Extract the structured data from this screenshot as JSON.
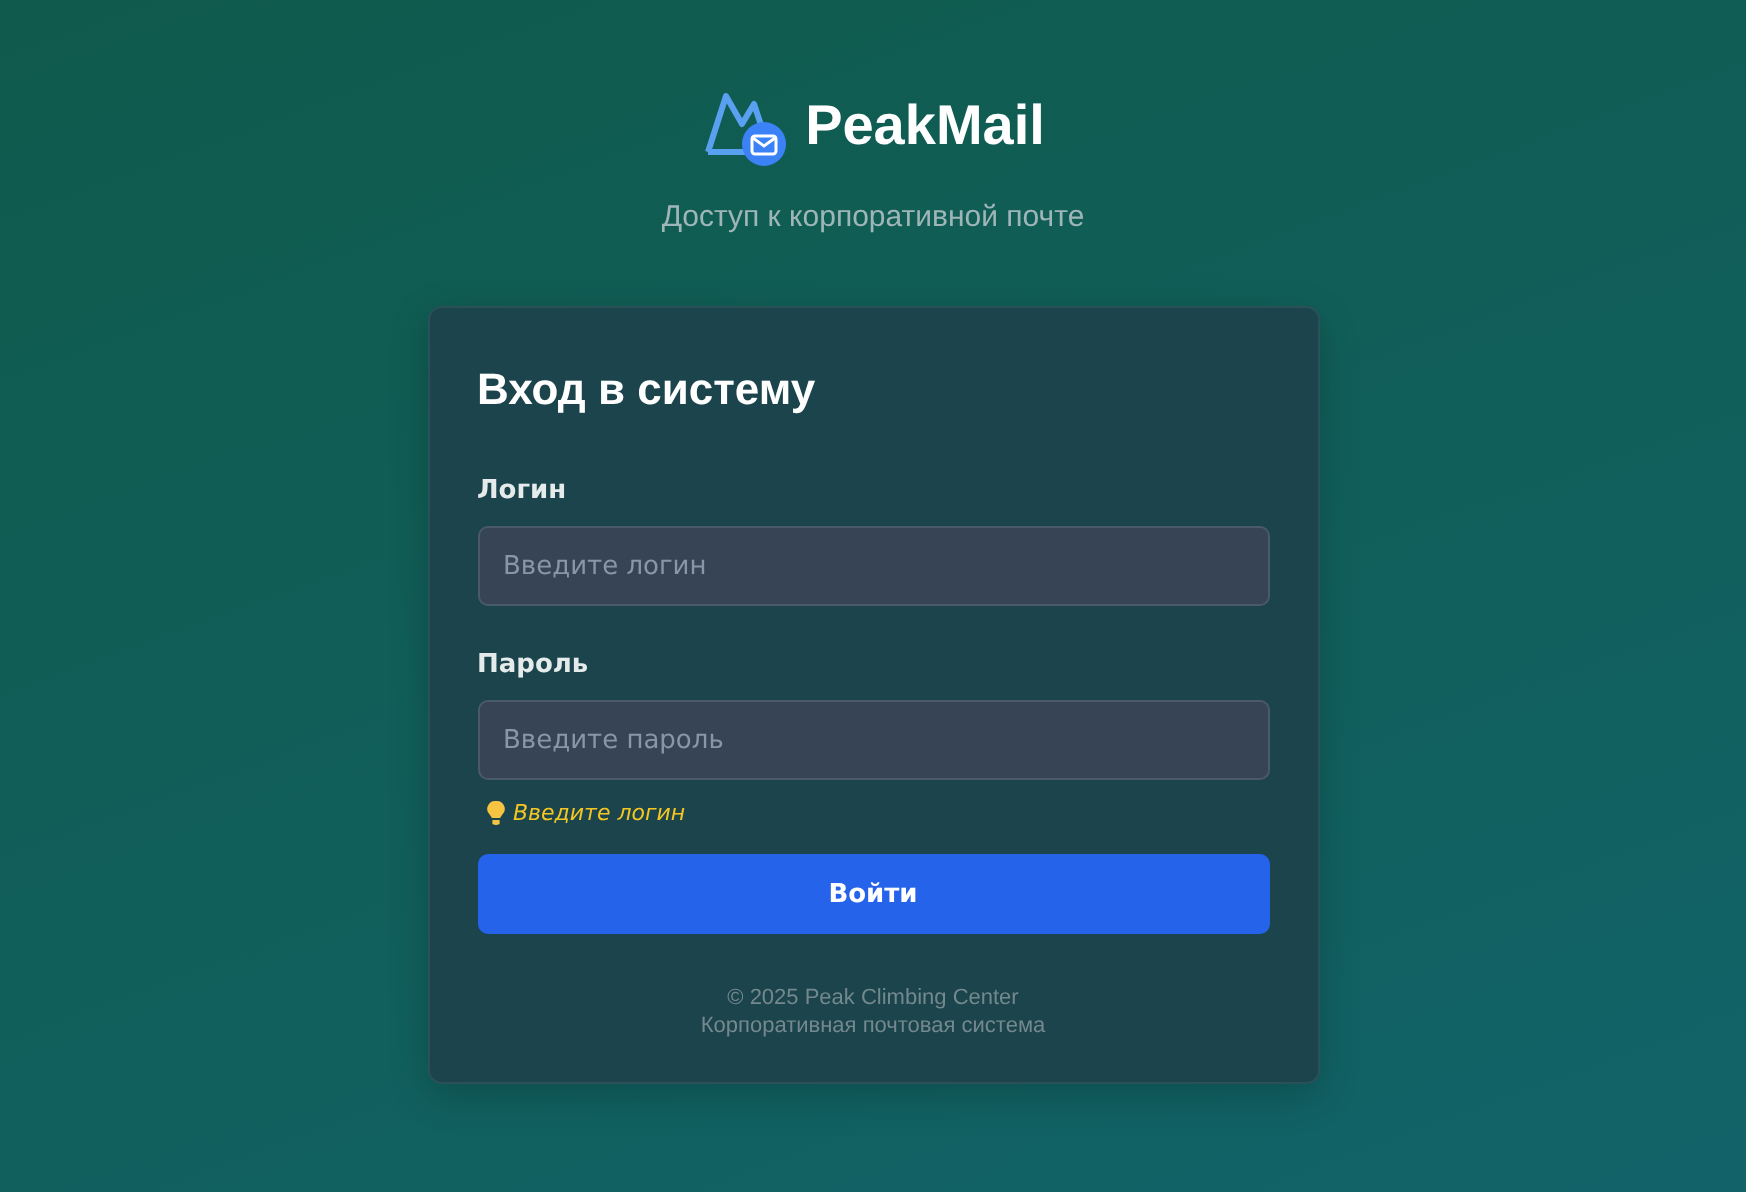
{
  "brand": {
    "name": "PeakMail",
    "tagline": "Доступ к корпоративной почте"
  },
  "card": {
    "title": "Вход в систему",
    "fields": [
      {
        "label": "Логин",
        "placeholder": "Введите логин"
      },
      {
        "label": "Пароль",
        "placeholder": "Введите пароль"
      }
    ],
    "hint": "Введите логин",
    "submit": "Войти",
    "footer": [
      "© 2025 Peak Climbing Center",
      "Корпоративная почтовая система"
    ]
  }
}
